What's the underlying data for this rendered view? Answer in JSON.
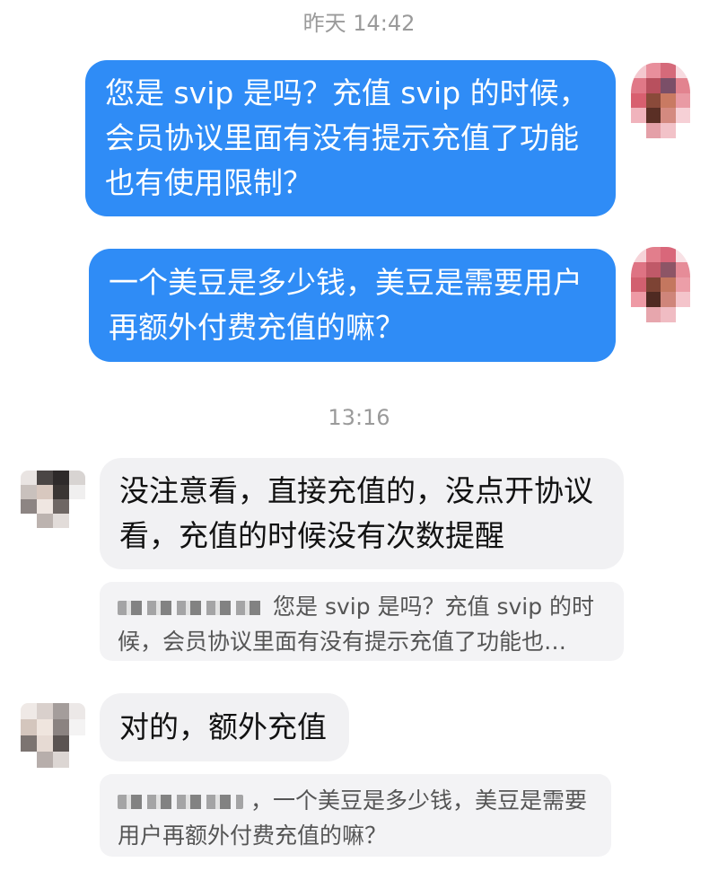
{
  "timestamps": {
    "first": "昨天 14:42",
    "second": "13:16"
  },
  "messages": {
    "out1": "您是 svip 是吗？充值 svip 的时候，会员协议里面有没有提示充值了功能也有使用限制？",
    "out2": "一个美豆是多少钱，美豆是需要用户再额外付费充值的嘛？",
    "in1": "没注意看，直接充值的，没点开协议看，充值的时候没有次数提醒",
    "in2": "对的，额外充值"
  },
  "quotes": {
    "q1": "您是 svip 是吗？充值 svip 的时候，会员协议里面有没有提示充值了功能也…",
    "q2": "，一个美豆是多少钱，美豆是需要用户再额外付费充值的嘛？"
  },
  "colors": {
    "outgoing_bubble": "#2f8cf6",
    "incoming_bubble": "#f1f1f3",
    "quote_background": "#f3f3f5",
    "timestamp_text": "#9a9a9a"
  },
  "icons": {
    "self_avatar": "pixelated-avatar",
    "contact_avatar": "pixelated-avatar"
  }
}
